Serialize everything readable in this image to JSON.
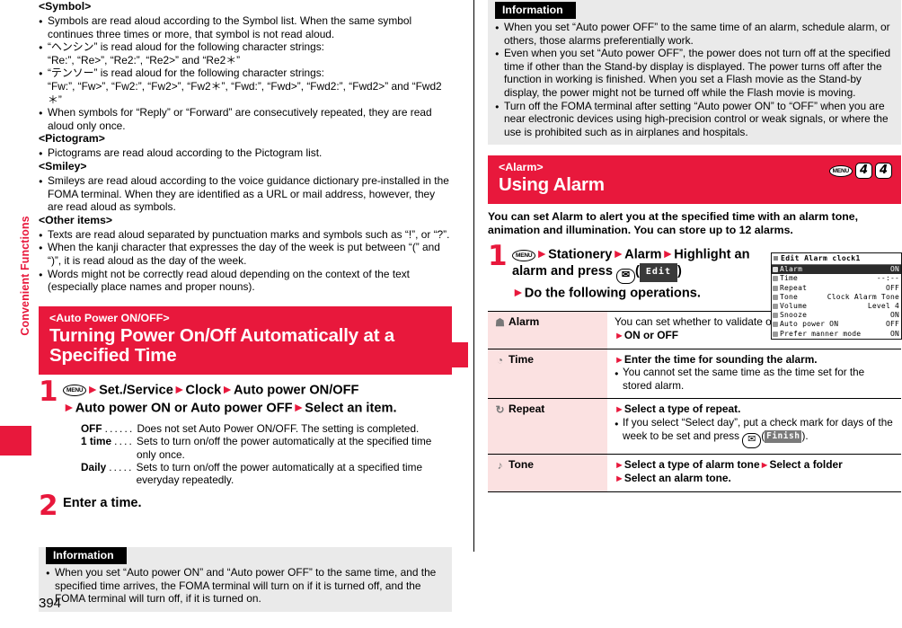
{
  "side_tab": {
    "label": "Convenient Functions"
  },
  "page_number": "394",
  "left_column": {
    "symbol_heading": "<Symbol>",
    "symbol_bullets": [
      "Symbols are read aloud according to the Symbol list. When the same symbol continues three times or more, that symbol is not read aloud.",
      "“ヘンシン” is read aloud for the following character strings:",
      "“テンソー” is read aloud for the following character strings:",
      "When symbols for “Reply” or “Forward” are consecutively repeated, they are read aloud only once."
    ],
    "henshin_strings": "“Re:”, “Re>”, “Re2:”, “Re2>” and “Re2＊”",
    "tenso_strings": "“Fw:”, “Fw>”, “Fw2:”, “Fw2>”, “Fw2＊”, “Fwd:”, “Fwd>”, “Fwd2:”, “Fwd2>” and “Fwd2＊”",
    "pictogram_heading": "<Pictogram>",
    "pictogram_bullets": [
      "Pictograms are read aloud according to the Pictogram list."
    ],
    "smiley_heading": "<Smiley>",
    "smiley_bullets": [
      "Smileys are read aloud according to the voice guidance dictionary pre-installed in the FOMA terminal. When they are identified as a URL or mail address, however, they are read aloud as symbols."
    ],
    "other_heading": "<Other items>",
    "other_bullets": [
      "Texts are read aloud separated by punctuation marks and symbols such as “!”, or “?”.",
      "When the kanji character that expresses the day of the week is put between “(” and “)”, it is read aloud as the day of the week.",
      "Words might not be correctly read aloud depending on the context of the text (especially place names and proper nouns)."
    ],
    "section": {
      "eyebrow": "<Auto Power ON/OFF>",
      "title": "Turning Power On/Off Automatically at a Specified Time"
    },
    "step1": {
      "number": "1",
      "key_menu": "MENU",
      "part1": "Set./Service",
      "part2": "Clock",
      "part3": "Auto power ON/OFF",
      "part4": "Auto power ON or Auto power OFF",
      "part5": "Select an item."
    },
    "options": [
      {
        "term": "OFF",
        "dots": "......",
        "desc": "Does not set Auto Power ON/OFF. The setting is completed."
      },
      {
        "term": "1 time",
        "dots": "....",
        "desc": "Sets to turn on/off the power automatically at the specified time only once."
      },
      {
        "term": "Daily",
        "dots": ".....",
        "desc": "Sets to turn on/off the power automatically at a specified time everyday repeatedly."
      }
    ],
    "step2": {
      "number": "2",
      "text": "Enter a time."
    },
    "info": {
      "tag": "Information",
      "bullets": [
        "When you set “Auto power ON” and “Auto power OFF” to the same time, and the specified time arrives, the FOMA terminal will turn on if it is turned off, and the FOMA terminal will turn off, if it is turned on."
      ]
    }
  },
  "right_column": {
    "info": {
      "tag": "Information",
      "bullets": [
        "When you set “Auto power OFF” to the same time of an alarm, schedule alarm, or others, those alarms preferentially work.",
        "Even when you set “Auto power OFF”, the power does not turn off at the specified time if other than the Stand-by display is displayed. The power turns off after the function in working is finished. When you set a Flash movie as the Stand-by display, the power might not be turned off while the Flash movie is moving.",
        "Turn off the FOMA terminal after setting “Auto power ON” to “OFF” when you are near electronic devices using high-precision control or weak signals, or where the use is prohibited such as in airplanes and hospitals."
      ]
    },
    "section": {
      "eyebrow": "<Alarm>",
      "title": "Using Alarm",
      "keys": [
        "MENU",
        "4",
        "4"
      ]
    },
    "intro": "You can set Alarm to alert you at the specified time with an alarm tone, animation and illumination. You can store up to 12 alarms.",
    "step1": {
      "number": "1",
      "key_menu": "MENU",
      "part1": "Stationery",
      "part2": "Alarm",
      "part3": "Highlight an alarm and press",
      "key_mail": "✉",
      "softkey": "Edit",
      "part4": "Do the following operations."
    },
    "phone_screen": {
      "title": "Edit Alarm clock1",
      "rows": [
        {
          "label": "Alarm",
          "value": "ON",
          "selected": true
        },
        {
          "label": "Time",
          "value": "--:--",
          "selected": false
        },
        {
          "label": "Repeat",
          "value": "OFF",
          "selected": false
        },
        {
          "label": "Tone",
          "value": "Clock Alarm Tone",
          "selected": false
        },
        {
          "label": "Volume",
          "value": "Level 4",
          "selected": false
        },
        {
          "label": "Snooze",
          "value": "ON",
          "selected": false
        },
        {
          "label": "Auto power ON",
          "value": "OFF",
          "selected": false
        },
        {
          "label": "Prefer manner mode",
          "value": "ON",
          "selected": false
        }
      ]
    },
    "table": [
      {
        "icon": "bell-icon",
        "glyph": "☗",
        "label": "Alarm",
        "desc": "You can set whether to validate or invalidate the alarm.",
        "action": "ON or OFF",
        "notes": []
      },
      {
        "icon": "clock-icon",
        "glyph": "◔",
        "label": "Time",
        "desc": "",
        "action": "Enter the time for sounding the alarm.",
        "notes": [
          "You cannot set the same time as the time set for the stored alarm."
        ]
      },
      {
        "icon": "repeat-icon",
        "glyph": "↻",
        "label": "Repeat",
        "desc": "",
        "action": "Select a type of repeat.",
        "notes": [
          "If you select “Select day”, put a check mark for days of the week to be set and press"
        ],
        "note_softkey": "Finish",
        "note_key_mail": "✉"
      },
      {
        "icon": "music-note-icon",
        "glyph": "♪",
        "label": "Tone",
        "desc": "",
        "action": "Select a type of alarm tone",
        "action2": "Select a folder",
        "action3": "Select an alarm tone.",
        "notes": []
      }
    ]
  }
}
